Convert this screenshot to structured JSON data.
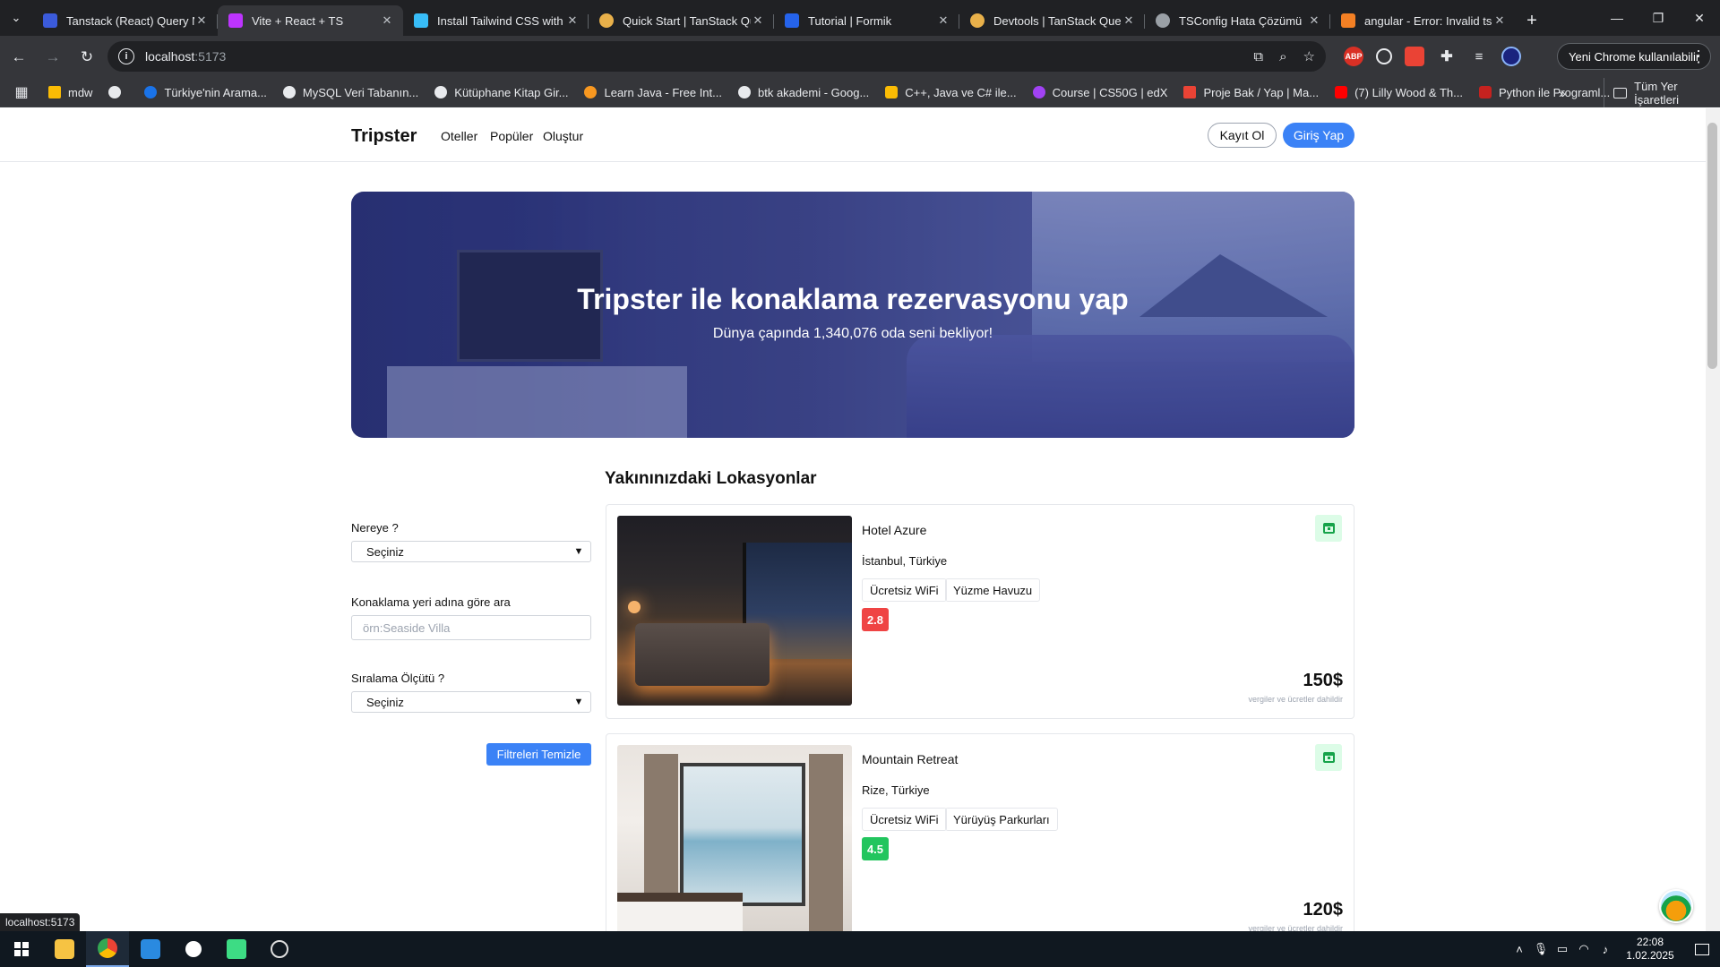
{
  "browser": {
    "tabs": [
      {
        "title": "Tanstack (React) Query Ne",
        "favicon_color": "#3b5bdb",
        "active": false
      },
      {
        "title": "Vite + React + TS",
        "favicon_color": "#bd34fe",
        "active": true
      },
      {
        "title": "Install Tailwind CSS with V",
        "favicon_color": "#38bdf8",
        "active": false
      },
      {
        "title": "Quick Start | TanStack Que",
        "favicon_color": "#e8b04a",
        "active": false
      },
      {
        "title": "Tutorial | Formik",
        "favicon_color": "#2563eb",
        "active": false
      },
      {
        "title": "Devtools | TanStack Query",
        "favicon_color": "#e8b04a",
        "active": false
      },
      {
        "title": "TSConfig Hata Çözümü",
        "favicon_color": "#9aa0a6",
        "active": false
      },
      {
        "title": "angular - Error: Invalid tsc",
        "favicon_color": "#f48024",
        "active": false
      }
    ],
    "url_host": "localhost",
    "url_port": ":5173",
    "profile_label": "Yeni Chrome kullanılabilir",
    "bookmarks": [
      {
        "label": "mdw",
        "color": "#fbbc04"
      },
      {
        "label": "Türkiye'nin Arama...",
        "color": "#1a73e8"
      },
      {
        "label": "MySQL Veri Tabanın...",
        "color": "#e8eaed"
      },
      {
        "label": "Kütüphane Kitap Gir...",
        "color": "#e8eaed"
      },
      {
        "label": "Learn Java - Free Int...",
        "color": "#f89820"
      },
      {
        "label": "btk akademi - Goog...",
        "color": "#e8eaed"
      },
      {
        "label": "C++, Java ve C# ile...",
        "color": "#fbbc04"
      },
      {
        "label": "Course | CS50G | edX",
        "color": "#a142f4"
      },
      {
        "label": "Proje Bak / Yap | Ma...",
        "color": "#ea4335"
      },
      {
        "label": "(7) Lilly Wood & Th...",
        "color": "#ff0000"
      },
      {
        "label": "Python ile Programl...",
        "color": "#c5221f"
      }
    ],
    "all_bookmarks_label": "Tüm Yer İşaretleri",
    "status_url": "localhost:5173"
  },
  "site": {
    "brand": "Tripster",
    "nav": [
      "Oteller",
      "Popüler",
      "Oluştur"
    ],
    "register_label": "Kayıt Ol",
    "login_label": "Giriş Yap",
    "hero_title": "Tripster ile konaklama rezervasyonu yap",
    "hero_subtitle": "Dünya çapında 1,340,076 oda seni bekliyor!",
    "section_title": "Yakınınızdaki Lokasyonlar",
    "filters": {
      "where_label": "Nereye ?",
      "where_value": "Seçiniz",
      "search_label": "Konaklama yeri adına göre ara",
      "search_placeholder": "örn:Seaside Villa",
      "sort_label": "Sıralama Ölçütü ?",
      "sort_value": "Seçiniz",
      "clear_label": "Filtreleri Temizle"
    },
    "hotels": [
      {
        "name": "Hotel Azure",
        "location": "İstanbul, Türkiye",
        "amenities": [
          "Ücretsiz WiFi",
          "Yüzme Havuzu"
        ],
        "rating": "2.8",
        "rating_color": "#ef4444",
        "price": "150$",
        "price_note": "vergiler ve ücretler dahildir"
      },
      {
        "name": "Mountain Retreat",
        "location": "Rize, Türkiye",
        "amenities": [
          "Ücretsiz WiFi",
          "Yürüyüş Parkurları"
        ],
        "rating": "4.5",
        "rating_color": "#22c55e",
        "price": "120$",
        "price_note": "vergiler ve ücretler dahildir"
      }
    ]
  },
  "taskbar": {
    "time": "22:08",
    "date": "1.02.2025"
  }
}
